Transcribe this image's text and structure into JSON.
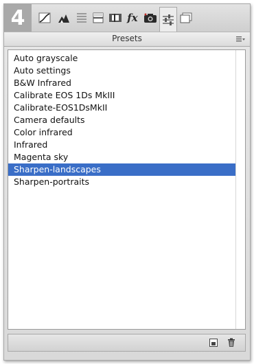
{
  "step_number": "4",
  "tabs": [
    {
      "icon": "tone-curve-icon"
    },
    {
      "icon": "color-mountains-icon"
    },
    {
      "icon": "hsl-bars-icon"
    },
    {
      "icon": "split-toning-icon"
    },
    {
      "icon": "lens-correction-icon"
    },
    {
      "icon": "effects-fx-icon",
      "label": "fx"
    },
    {
      "icon": "camera-calibration-icon"
    },
    {
      "icon": "presets-sliders-icon",
      "active": true
    },
    {
      "icon": "snapshots-icon"
    }
  ],
  "panel": {
    "title": "Presets",
    "menu_icon": "panel-menu-icon"
  },
  "presets": {
    "items": [
      "Auto grayscale",
      "Auto settings",
      "B&W Infrared",
      "Calibrate EOS 1Ds MkIII",
      "Calibrate-EOS1DsMkII",
      "Camera defaults",
      "Color infrared",
      "Infrared",
      "Magenta sky",
      "Sharpen-landscapes",
      "Sharpen-portraits"
    ],
    "selected": "Sharpen-landscapes"
  },
  "bottom_bar": {
    "buttons": [
      {
        "icon": "new-preset-icon"
      },
      {
        "icon": "trash-icon"
      }
    ]
  },
  "colors": {
    "selection": "#3a6ec7",
    "badge": "#a9a9a9"
  }
}
